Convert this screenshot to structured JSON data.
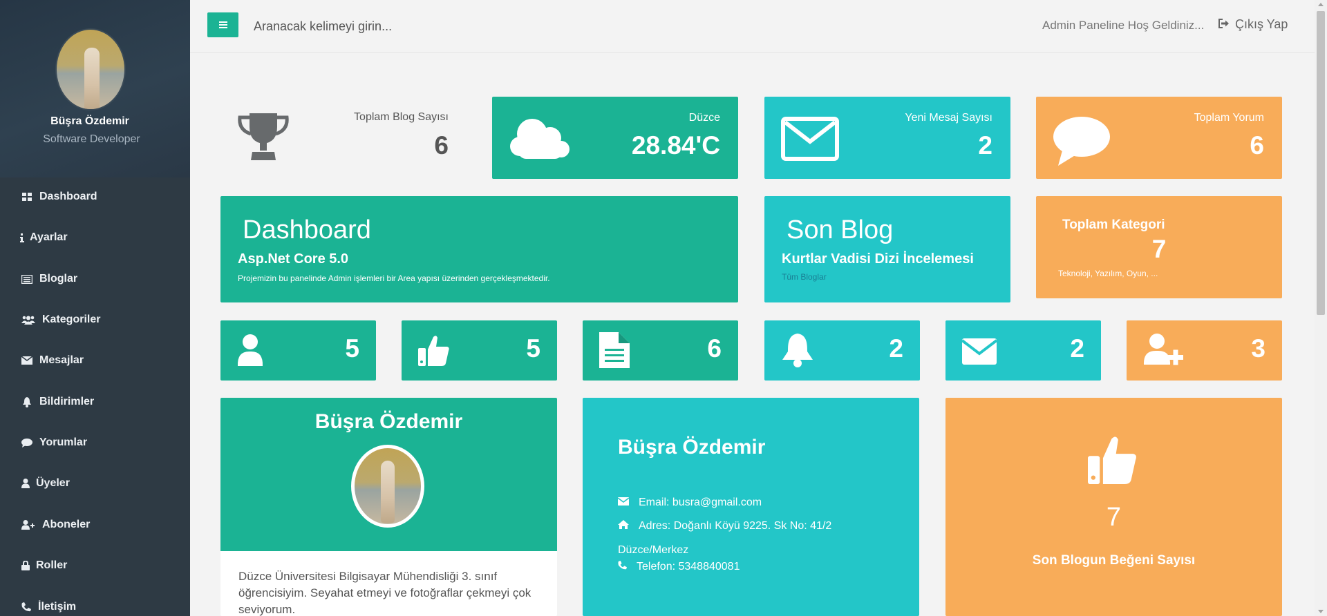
{
  "sidebar": {
    "profile": {
      "name": "Büşra Özdemir",
      "role": "Software Developer"
    },
    "items": [
      {
        "label": "Dashboard",
        "icon": "grid-icon"
      },
      {
        "label": "Ayarlar",
        "icon": "info-icon"
      },
      {
        "label": "Bloglar",
        "icon": "list-icon"
      },
      {
        "label": "Kategoriler",
        "icon": "users-icon"
      },
      {
        "label": "Mesajlar",
        "icon": "envelope-icon"
      },
      {
        "label": "Bildirimler",
        "icon": "bell-icon"
      },
      {
        "label": "Yorumlar",
        "icon": "comment-icon"
      },
      {
        "label": "Üyeler",
        "icon": "user-icon"
      },
      {
        "label": "Aboneler",
        "icon": "user-plus-icon"
      },
      {
        "label": "Roller",
        "icon": "lock-icon"
      },
      {
        "label": "İletişim",
        "icon": "phone-icon"
      }
    ]
  },
  "topbar": {
    "search_placeholder": "Aranacak kelimeyi girin...",
    "welcome": "Admin Paneline Hoş Geldiniz...",
    "logout": "Çıkış Yap"
  },
  "stats": {
    "blog": {
      "label": "Toplam Blog Sayısı",
      "value": "6"
    },
    "weather": {
      "label": "Düzce",
      "value": "28.84'C"
    },
    "messages": {
      "label": "Yeni Mesaj Sayısı",
      "value": "2"
    },
    "comments": {
      "label": "Toplam Yorum",
      "value": "6"
    }
  },
  "dashboard_card": {
    "title": "Dashboard",
    "subtitle": "Asp.Net Core 5.0",
    "desc": "Projemizin bu panelinde Admin işlemleri bir Area yapısı üzerinden gerçekleşmektedir."
  },
  "last_blog": {
    "title": "Son Blog",
    "blog_title": "Kurtlar Vadisi Dizi İncelemesi",
    "link": "Tüm Bloglar"
  },
  "categories": {
    "title": "Toplam Kategori",
    "value": "7",
    "list": "Teknoloji, Yazılım, Oyun, ..."
  },
  "mini_stats": [
    {
      "icon": "user-icon",
      "value": "5"
    },
    {
      "icon": "thumbs-up-icon",
      "value": "5"
    },
    {
      "icon": "file-icon",
      "value": "6"
    },
    {
      "icon": "bell-icon",
      "value": "2"
    },
    {
      "icon": "envelope-icon",
      "value": "2"
    },
    {
      "icon": "user-plus-icon",
      "value": "3"
    }
  ],
  "profile_card": {
    "name": "Büşra Özdemir",
    "bio": "Düzce Üniversitesi Bilgisayar Mühendisliği 3. sınıf öğrencisiyim. Seyahat etmeyi ve fotoğraflar çekmeyi çok seviyorum."
  },
  "contact_card": {
    "name": "Büşra Özdemir",
    "email": "Email: busra@gmail.com",
    "address": "Adres: Doğanlı Köyü 9225. Sk No: 41/2",
    "city": "Düzce/Merkez",
    "phone": "Telefon: 5348840081"
  },
  "likes_card": {
    "value": "7",
    "label": "Son Blogun Beğeni Sayısı"
  },
  "colors": {
    "sidebar": "#2e3a44",
    "green": "#1bb394",
    "cyan": "#23c6c8",
    "orange": "#f8ac59",
    "background": "#f3f3f3"
  }
}
